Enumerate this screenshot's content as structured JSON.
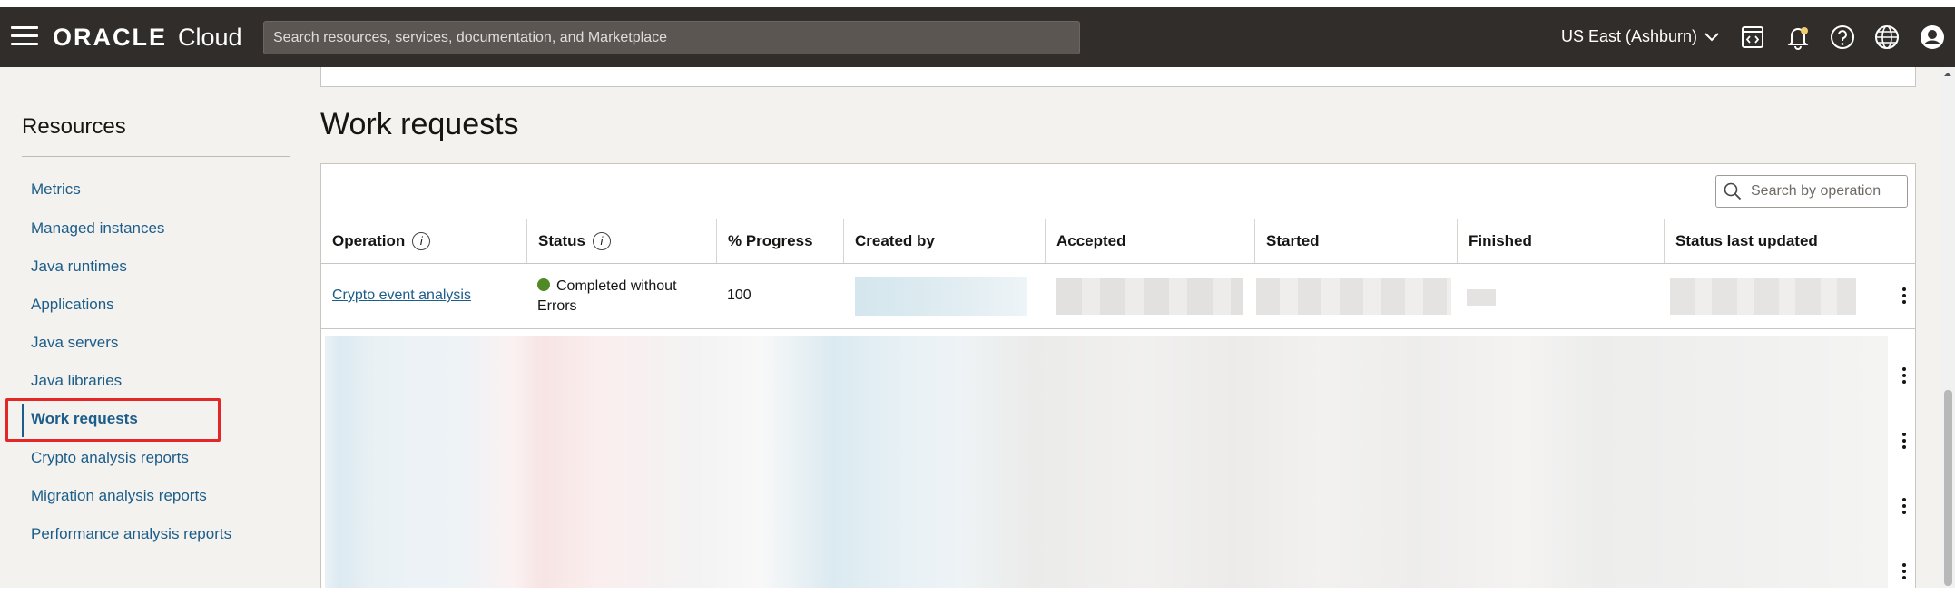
{
  "header": {
    "brand_oracle": "ORACLE",
    "brand_cloud": "Cloud",
    "search_placeholder": "Search resources, services, documentation, and Marketplace",
    "region": "US East (Ashburn)",
    "icons": [
      "menu-icon",
      "code-editor-icon",
      "bell-icon",
      "help-icon",
      "globe-icon",
      "user-icon"
    ]
  },
  "sidebar": {
    "title": "Resources",
    "items": [
      {
        "label": "Metrics"
      },
      {
        "label": "Managed instances"
      },
      {
        "label": "Java runtimes"
      },
      {
        "label": "Applications"
      },
      {
        "label": "Java servers"
      },
      {
        "label": "Java libraries"
      },
      {
        "label": "Work requests",
        "active": true
      },
      {
        "label": "Crypto analysis reports"
      },
      {
        "label": "Migration analysis reports"
      },
      {
        "label": "Performance analysis reports"
      }
    ]
  },
  "main": {
    "title": "Work requests",
    "search_placeholder": "Search by operation",
    "columns": [
      "Operation",
      "Status",
      "% Progress",
      "Created by",
      "Accepted",
      "Started",
      "Finished",
      "Status last updated"
    ],
    "rows": [
      {
        "operation": "Crypto event analysis",
        "status": "Completed without Errors",
        "progress": "100"
      }
    ]
  },
  "colors": {
    "topbar": "#312d2a",
    "link": "#1c5d89",
    "status_ok": "#4f8a26",
    "highlight": "#e32626"
  }
}
